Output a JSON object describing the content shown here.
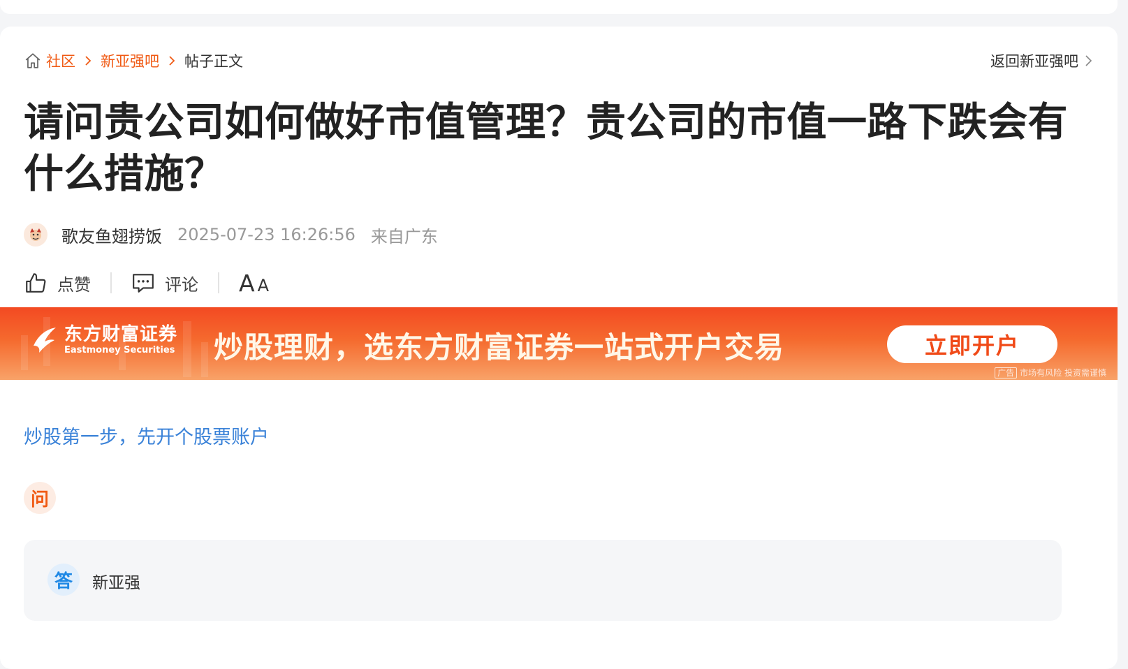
{
  "breadcrumb": {
    "items": [
      "社区",
      "新亚强吧"
    ],
    "current": "帖子正文"
  },
  "back_link": "返回新亚强吧",
  "post": {
    "title": "请问贵公司如何做好市值管理？贵公司的市值一路下跌会有什么措施？",
    "author": "歌友鱼翅捞饭",
    "time": "2025-07-23 16:26:56",
    "location": "来自广东"
  },
  "actions": {
    "like": "点赞",
    "comment": "评论",
    "font_big": "A",
    "font_small": "A"
  },
  "banner": {
    "brand_cn": "东方财富证券",
    "brand_en": "Eastmoney Securities",
    "slogan": "炒股理财，选东方财富证券一站式开户交易",
    "cta": "立即开户",
    "ad_tag": "广告",
    "risk": "市场有风险 投资需谨慎"
  },
  "promo_link": "炒股第一步，先开个股票账户",
  "question_badge": "问",
  "reply": {
    "badge": "答",
    "name": "新亚强"
  },
  "colors": {
    "accent": "#f05a14",
    "link_blue": "#3a82d8",
    "reply_blue": "#1e88e5"
  }
}
